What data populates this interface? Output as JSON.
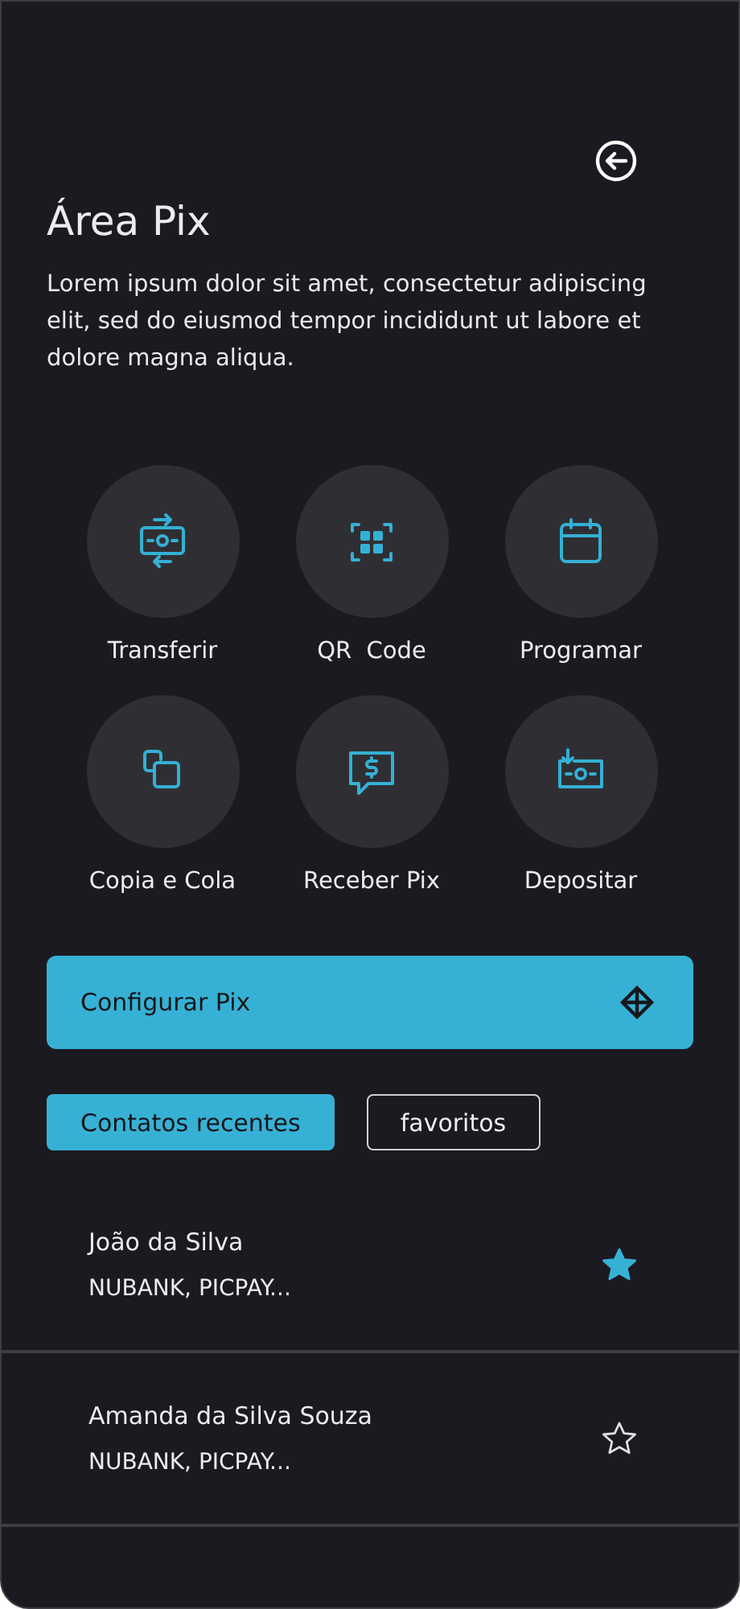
{
  "header": {
    "title": "Área Pix",
    "description": "Lorem ipsum dolor sit amet, consectetur adipiscing elit, sed do eiusmod tempor incididunt ut labore et dolore magna aliqua."
  },
  "actions": [
    {
      "kind": "transfer",
      "label": "Transferir"
    },
    {
      "kind": "qr",
      "label": "QR  Code"
    },
    {
      "kind": "calendar",
      "label": "Programar"
    },
    {
      "kind": "copy",
      "label": "Copia e Cola"
    },
    {
      "kind": "receive",
      "label": "Receber Pix"
    },
    {
      "kind": "deposit",
      "label": "Depositar"
    }
  ],
  "config_button": {
    "label": "Configurar Pix"
  },
  "tabs": [
    {
      "label": "Contatos recentes",
      "selected": true
    },
    {
      "label": "favoritos",
      "selected": false
    }
  ],
  "contacts": [
    {
      "name": "João da Silva",
      "banks": "NUBANK, PICPAY...",
      "favorite": true
    },
    {
      "name": "Amanda da Silva Souza",
      "banks": "NUBANK, PICPAY...",
      "favorite": false
    }
  ]
}
